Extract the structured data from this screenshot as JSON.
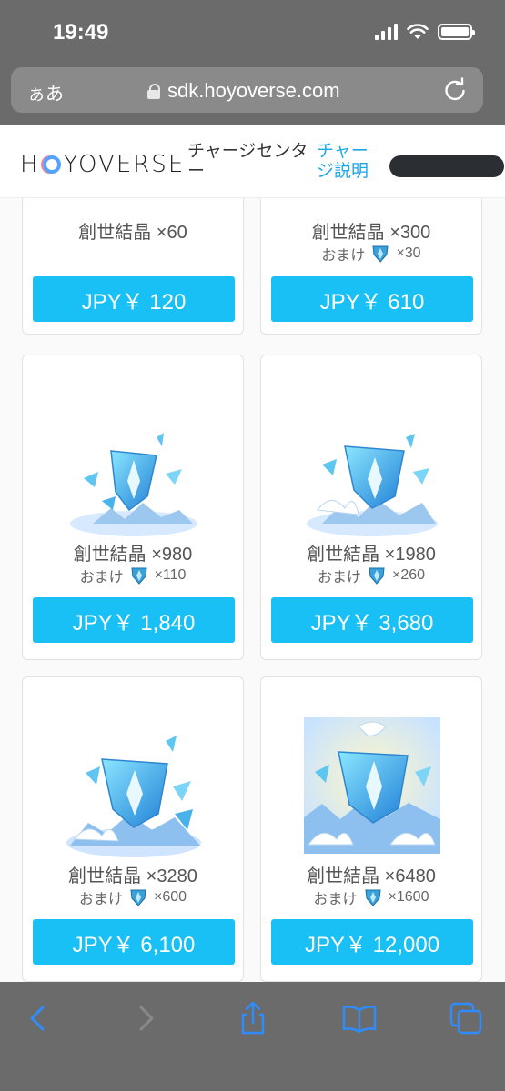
{
  "status": {
    "time": "19:49"
  },
  "browser": {
    "aa_label": "ぁあ",
    "url": "sdk.hoyoverse.com"
  },
  "header": {
    "logo": "HOYOVERSE",
    "logo_parts": [
      "H",
      "YOVERSE"
    ],
    "title": "チャージセンター",
    "link": "チャージ説明"
  },
  "products": [
    {
      "name": "創世結晶 ×60",
      "bonus_label": "",
      "bonus_amount": "",
      "price": "JPY￥ 120"
    },
    {
      "name": "創世結晶 ×300",
      "bonus_label": "おまけ",
      "bonus_amount": "×30",
      "price": "JPY￥ 610"
    },
    {
      "name": "創世結晶 ×980",
      "bonus_label": "おまけ",
      "bonus_amount": "×110",
      "price": "JPY￥ 1,840"
    },
    {
      "name": "創世結晶 ×1980",
      "bonus_label": "おまけ",
      "bonus_amount": "×260",
      "price": "JPY￥ 3,680"
    },
    {
      "name": "創世結晶 ×3280",
      "bonus_label": "おまけ",
      "bonus_amount": "×600",
      "price": "JPY￥ 6,100"
    },
    {
      "name": "創世結晶 ×6480",
      "bonus_label": "おまけ",
      "bonus_amount": "×1600",
      "price": "JPY￥ 12,000"
    }
  ],
  "colors": {
    "accent": "#18c0f5",
    "link": "#1aa8e8",
    "chrome": "#6b6b6b"
  },
  "icons": [
    "lock-icon",
    "reload-icon",
    "back-icon",
    "forward-icon",
    "share-icon",
    "bookmarks-icon",
    "tabs-icon",
    "crystal-icon"
  ]
}
